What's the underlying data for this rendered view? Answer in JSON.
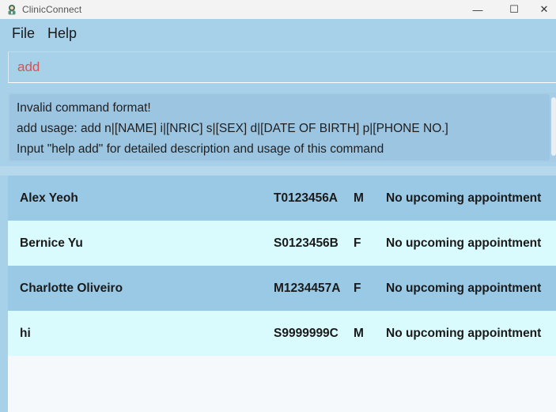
{
  "window": {
    "title": "ClinicConnect",
    "controls": {
      "minimize": "—",
      "maximize": "☐",
      "close": "✕"
    }
  },
  "menu": {
    "items": [
      {
        "label": "File"
      },
      {
        "label": "Help"
      }
    ]
  },
  "command": {
    "value": "add"
  },
  "result": {
    "lines": [
      "Invalid command format!",
      "add usage: add n|[NAME] i|[NRIC] s|[SEX] d|[DATE OF BIRTH] p|[PHONE NO.]",
      "Input \"help add\" for detailed description and usage of this command"
    ]
  },
  "patients": [
    {
      "name": "Alex Yeoh",
      "nric": "T0123456A",
      "sex": "M",
      "appointment": "No upcoming appointment"
    },
    {
      "name": "Bernice Yu",
      "nric": "S0123456B",
      "sex": "F",
      "appointment": "No upcoming appointment"
    },
    {
      "name": "Charlotte Oliveiro",
      "nric": "M1234457A",
      "sex": "F",
      "appointment": "No upcoming appointment"
    },
    {
      "name": "hi",
      "nric": "S9999999C",
      "sex": "M",
      "appointment": "No upcoming appointment"
    }
  ],
  "colors": {
    "background": "#a7d0e9",
    "row_odd": "#9ac9e6",
    "row_even": "#d9fbfd",
    "command_text": "#d9534f"
  },
  "icons": {
    "app": "clinic-app-icon"
  }
}
